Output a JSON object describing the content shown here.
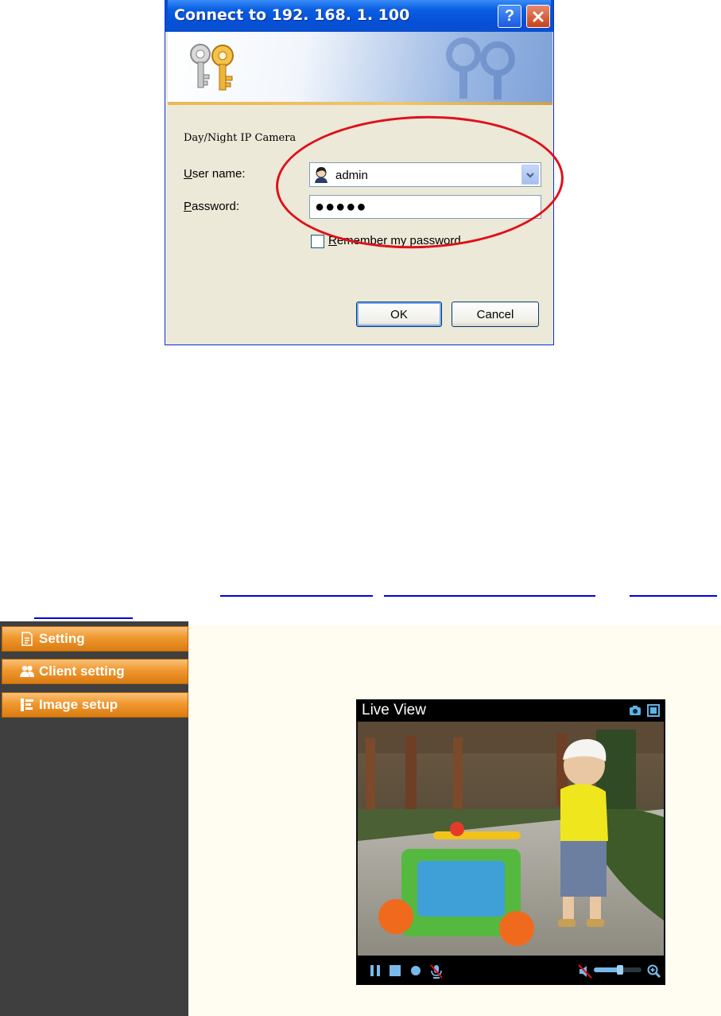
{
  "dialog": {
    "title": "Connect to 192. 168. 1. 100",
    "help_label": "?",
    "realm": "Day/Night IP Camera",
    "username_label_underlined": "U",
    "username_label_rest": "ser name:",
    "username_value": "admin",
    "password_label_underlined": "P",
    "password_label_rest": "assword:",
    "password_mask": "●●●●●",
    "remember_label_underlined": "R",
    "remember_label_rest": "emember my password",
    "ok_label": "OK",
    "cancel_label": "Cancel"
  },
  "sidebar": {
    "items": [
      {
        "label": "Setting",
        "icon": "document-icon"
      },
      {
        "label": "Client setting",
        "icon": "users-icon"
      },
      {
        "label": "Image setup",
        "icon": "image-setup-icon"
      }
    ]
  },
  "player": {
    "title": "Live View",
    "volume_level": 0.55
  },
  "colors": {
    "xp_title_blue": "#0550d6",
    "highlight_red": "#e0101a",
    "sidebar_orange": "#f0982f",
    "sidebar_bg": "#3f3f3f",
    "main_bg": "#fffdf2"
  }
}
